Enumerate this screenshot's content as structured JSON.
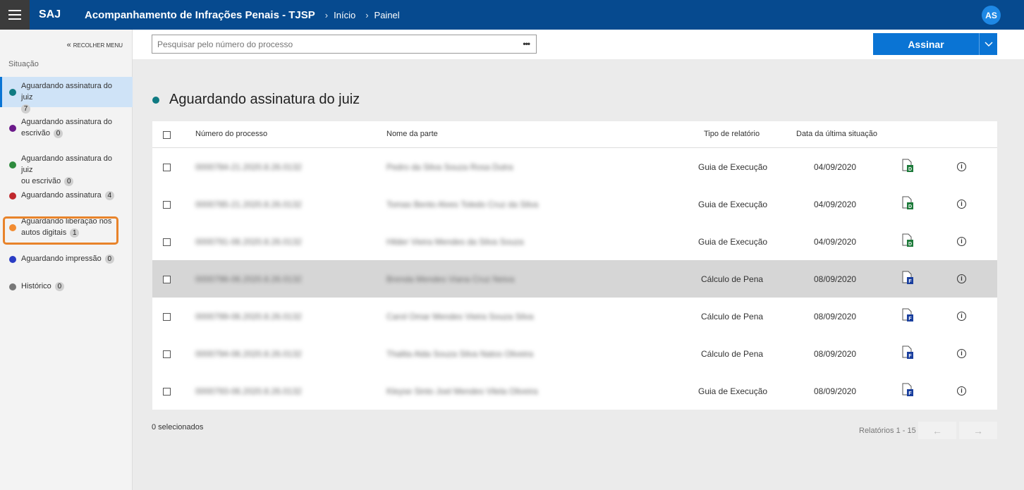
{
  "header": {
    "brand": "SAJ",
    "title": "Acompanhamento de Infrações Penais - TJSP",
    "breadcrumb": [
      "Início",
      "Painel"
    ],
    "avatar": "AS"
  },
  "sidebar": {
    "collapse_label": "RECOLHER MENU",
    "title": "Situação",
    "items": [
      {
        "label": "Aguardando assinatura do juiz",
        "count": "7",
        "color": "#0f7a82"
      },
      {
        "label": "Aguardando assinatura do escrivão",
        "count": "0",
        "color": "#6b1a8a"
      },
      {
        "label": "Aguardando assinatura do juiz ou escrivão",
        "count": "0",
        "color": "#2e8b3e"
      },
      {
        "label": "Aguardando assinatura",
        "count": "4",
        "color": "#c0282d"
      },
      {
        "label": "Aguardando liberação nos autos digitais",
        "count": "1",
        "color": "#f28b30"
      },
      {
        "label": "Aguardando impressão",
        "count": "0",
        "color": "#2a3cc4"
      },
      {
        "label": "Histórico",
        "count": "0",
        "color": "#777777"
      }
    ]
  },
  "toolbar": {
    "search_placeholder": "Pesquisar pelo número do processo",
    "sign_label": "Assinar"
  },
  "section": {
    "title": "Aguardando assinatura do juiz",
    "color": "#0f7a82"
  },
  "table": {
    "columns": [
      "Número do processo",
      "Nome da parte",
      "Tipo de relatório",
      "Data da última situação"
    ],
    "rows": [
      {
        "process": "0000784-21.2020.8.26.0132",
        "party": "Pedro da Silva Souza Rosa Dutra",
        "type": "Guia de Execução",
        "date": "04/09/2020",
        "doc": "D"
      },
      {
        "process": "0000785-21.2020.8.26.0132",
        "party": "Tomas Bento Alves Toledo Cruz da Silva",
        "type": "Guia de Execução",
        "date": "04/09/2020",
        "doc": "D"
      },
      {
        "process": "0000791-06.2020.8.26.0132",
        "party": "Hilder Vieira Mendes da Silva Souza",
        "type": "Guia de Execução",
        "date": "04/09/2020",
        "doc": "D"
      },
      {
        "process": "0000796-06.2020.8.26.0132",
        "party": "Brenda Mendes Viana Cruz Neiva",
        "type": "Cálculo de Pena",
        "date": "08/09/2020",
        "doc": "F"
      },
      {
        "process": "0000799-06.2020.8.26.0132",
        "party": "Carol Omar Mendes Vieira Souza Silva",
        "type": "Cálculo de Pena",
        "date": "08/09/2020",
        "doc": "F"
      },
      {
        "process": "0000794-06.2020.8.26.0132",
        "party": "Thalita Alda Souza Silva Natos Oliveira",
        "type": "Cálculo de Pena",
        "date": "08/09/2020",
        "doc": "F"
      },
      {
        "process": "0000793-06.2020.8.26.0132",
        "party": "Kleyse Sinto Joel Mendes Vilela Oliveira",
        "type": "Guia de Execução",
        "date": "08/09/2020",
        "doc": "F"
      }
    ]
  },
  "footer": {
    "selected": "0 selecionados",
    "pager": "Relatórios 1 - 15"
  }
}
